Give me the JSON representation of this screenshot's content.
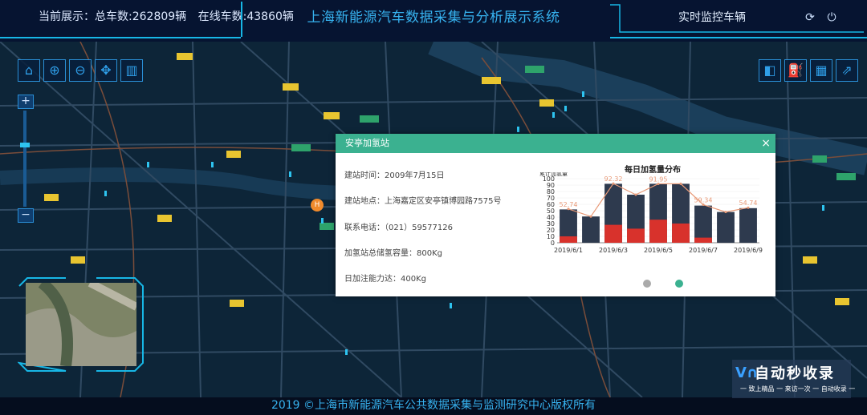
{
  "header": {
    "stats_total": "当前展示：总车数:262809辆",
    "stats_online": "在线车数:43860辆",
    "title": "上海新能源汽车数据采集与分析展示系统",
    "realtime_label": "实时监控车辆",
    "refresh_icon": "refresh-icon",
    "power_icon": "power-icon"
  },
  "toolbar": {
    "icons": [
      "home-icon",
      "zoom-in-rect-icon",
      "zoom-out-icon",
      "pan-icon",
      "trash-icon"
    ],
    "right_icons": [
      "camera-icon",
      "fuel-station-icon",
      "map-icon",
      "road-icon"
    ]
  },
  "zoom": {
    "plus": "+",
    "minus": "−"
  },
  "popup": {
    "title": "安亭加氢站",
    "close": "×",
    "build_time": "建站时间：2009年7月15日",
    "address": "建站地点：上海嘉定区安亭镇博园路7575号",
    "phone": "联系电话：（021）59577126",
    "storage": "加氢站总储氢容量：800Kg",
    "capacity": "日加注能力达：400Kg",
    "marker_label": "H"
  },
  "chart_data": {
    "type": "bar",
    "title": "每日加氢量分布",
    "ylabel": "累计加氢量",
    "ylim": [
      0,
      100
    ],
    "yticks": [
      0,
      10,
      20,
      30,
      40,
      50,
      60,
      70,
      80,
      90,
      100
    ],
    "categories": [
      "2019/6/1",
      "2019/6/2",
      "2019/6/3",
      "2019/6/4",
      "2019/6/5",
      "2019/6/6",
      "2019/6/7",
      "2019/6/8",
      "2019/6/9"
    ],
    "xtick_labels": [
      "2019/6/1",
      "2019/6/3",
      "2019/6/5",
      "2019/6/7",
      "2019/6/9"
    ],
    "series": [
      {
        "values": [
          52,
          41,
          92,
          75,
          92,
          92,
          58,
          48,
          54
        ],
        "color": "#2e3a4e"
      },
      {
        "values": [
          10,
          0,
          28,
          22,
          36,
          30,
          8,
          0,
          0
        ],
        "color": "#d8322c"
      }
    ],
    "line_values": [
      52.74,
      41,
      92.32,
      75,
      91.95,
      92,
      59.34,
      48,
      54.74
    ],
    "line_color": "#e89a78",
    "data_labels": [
      "52.74",
      "92.32",
      "91.95",
      "59.34",
      "54.74"
    ],
    "data_label_index": [
      0,
      2,
      4,
      6,
      8
    ]
  },
  "pager": {
    "dots": [
      "#aaaaaa",
      "#3bb190"
    ]
  },
  "footer": {
    "text": "2019 ©上海市新能源汽车公共数据采集与监测研究中心版权所有"
  },
  "watermark": {
    "title": "自动秒收录",
    "sub": "一 致上精品 一 来访一次 一 自动收录 一"
  },
  "colors": {
    "accent": "#17b7e6",
    "title": "#37b3f0",
    "popup_header": "#3bb190"
  }
}
